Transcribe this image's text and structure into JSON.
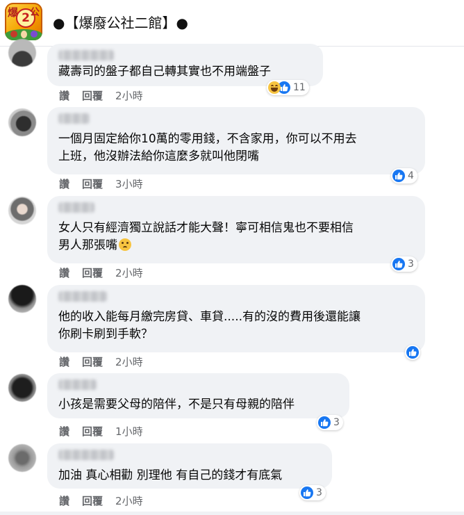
{
  "page": {
    "name": "●【爆廢公社二館】●",
    "logo_text": [
      "爆",
      "2",
      "公"
    ]
  },
  "comments": [
    {
      "text": [
        "藏壽司的盤子都自己轉其實也不用端盤子"
      ],
      "like_label": "讚",
      "reply_label": "回覆",
      "time": "2小時",
      "reactions": [
        "haha",
        "like"
      ],
      "reaction_count": "11"
    },
    {
      "text": [
        "一個月固定給你10萬的零用錢，不含家用，你可以不用去",
        "上班，他沒辦法給你這麼多就叫他閉嘴"
      ],
      "like_label": "讚",
      "reply_label": "回覆",
      "time": "3小時",
      "reactions": [
        "like"
      ],
      "reaction_count": "4"
    },
    {
      "text": [
        "女人只有經濟獨立說話才能大聲！寧可相信鬼也不要相信",
        "男人那張嘴"
      ],
      "emoji": "rolling-eyes",
      "like_label": "讚",
      "reply_label": "回覆",
      "time": "2小時",
      "reactions": [
        "like"
      ],
      "reaction_count": "3"
    },
    {
      "text": [
        "他的收入能每月繳完房貸、車貸.....有的沒的費用後還能讓",
        "你刷卡刷到手軟？"
      ],
      "like_label": "讚",
      "reply_label": "回覆",
      "time": "2小時",
      "reactions": [
        "like"
      ],
      "reaction_count": ""
    },
    {
      "text": [
        "小孩是需要父母的陪伴，不是只有母親的陪伴"
      ],
      "like_label": "讚",
      "reply_label": "回覆",
      "time": "1小時",
      "reactions": [
        "like"
      ],
      "reaction_count": "3"
    },
    {
      "text": [
        "加油 真心相勸 別理他 有自己的錢才有底氣"
      ],
      "like_label": "讚",
      "reply_label": "回覆",
      "time": "2小時",
      "reactions": [
        "like"
      ],
      "reaction_count": "3"
    }
  ],
  "colors": {
    "bubble": "#f0f2f5",
    "like_blue": "#1877f2",
    "meta_gray": "#65676b"
  }
}
